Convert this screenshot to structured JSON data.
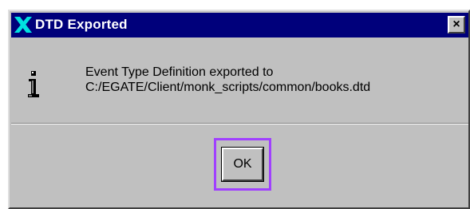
{
  "window": {
    "title": "DTD Exported",
    "close_label": "×"
  },
  "message": {
    "line1": "Event Type Definition exported to",
    "line2": "C:/EGATE/Client/monk_scripts/common/books.dtd"
  },
  "buttons": {
    "ok_label": "OK"
  },
  "icons": {
    "title_logo": "egate-x-logo-icon",
    "info": "info-icon"
  },
  "colors": {
    "titlebar": "#00007b",
    "dialog_bg": "#c0c0c0",
    "logo": "#00e0e0",
    "focus_ring": "#a040ff"
  }
}
